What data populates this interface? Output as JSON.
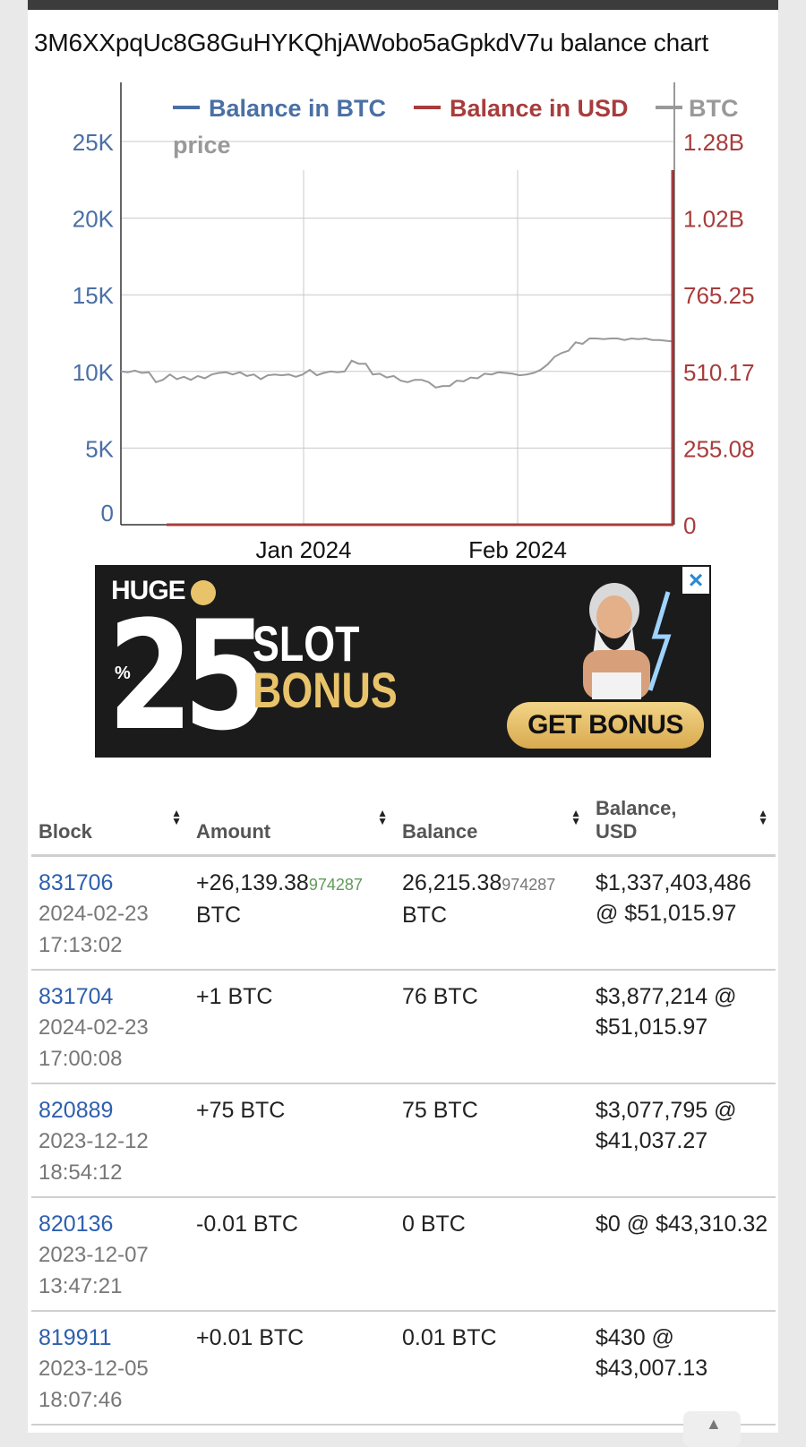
{
  "page_title": "3M6XXpqUc8G8GuHYKQhjAWobo5aGpkdV7u balance chart",
  "chart_data": {
    "type": "line",
    "legend": [
      {
        "label": "Balance in BTC",
        "color": "#4a6fa5"
      },
      {
        "label": "Balance in USD",
        "color": "#a83c3c"
      },
      {
        "label": "BTC price",
        "color": "#999999"
      }
    ],
    "legend_placement": "top",
    "grid": true,
    "y_left_ticks": [
      "0",
      "5K",
      "10K",
      "15K",
      "20K",
      "25K"
    ],
    "y_left_range": [
      0,
      25000
    ],
    "y_right_ticks": [
      "0",
      "255.08",
      "510.17",
      "765.25",
      "1.02B",
      "1.28B"
    ],
    "x_ticks": [
      "Jan 2024",
      "Feb 2024"
    ],
    "series": [
      {
        "name": "BTC price",
        "color": "#999999",
        "x": [
          0,
          1,
          2,
          3,
          4,
          5,
          6,
          7,
          8,
          9,
          10,
          11,
          12,
          13,
          14,
          15,
          16,
          17,
          18,
          19,
          20,
          21,
          22,
          23,
          24,
          25,
          26,
          27,
          28,
          29,
          30,
          31,
          32,
          33,
          34,
          35,
          36,
          37,
          38,
          39,
          40,
          41,
          42,
          43,
          44,
          45,
          46,
          47,
          48,
          49,
          50,
          51,
          52,
          53,
          54,
          55,
          56,
          57,
          58,
          59,
          60,
          61,
          62,
          63,
          64,
          65,
          66,
          67,
          68,
          69,
          70,
          71,
          72,
          73,
          74,
          75,
          76,
          77,
          78,
          79
        ],
        "values": [
          10000,
          9950,
          10050,
          9900,
          9950,
          9300,
          9450,
          9800,
          9500,
          9650,
          9450,
          9700,
          9550,
          9800,
          9900,
          9950,
          9800,
          9950,
          9700,
          9800,
          9500,
          9750,
          9800,
          9750,
          9800,
          9650,
          9800,
          10100,
          9750,
          9900,
          10000,
          9950,
          10000,
          10700,
          10500,
          10500,
          9800,
          9850,
          9600,
          9700,
          9400,
          9300,
          9450,
          9450,
          9300,
          8950,
          9050,
          9050,
          9400,
          9350,
          9600,
          9550,
          9850,
          9800,
          9950,
          9900,
          9850,
          9750,
          9800,
          9900,
          10100,
          10450,
          10950,
          11200,
          11350,
          11900,
          11800,
          12150,
          12150,
          12100,
          12150,
          12150,
          12050,
          12150,
          12100,
          12150,
          12050,
          12050,
          12000,
          11950
        ]
      },
      {
        "name": "Balance in BTC",
        "color": "#4a6fa5",
        "points": [
          [
            0,
            0
          ],
          [
            79,
            0
          ],
          [
            79,
            26215.38974287
          ]
        ]
      },
      {
        "name": "Balance in USD",
        "color": "#a83c3c",
        "points": [
          [
            0,
            0
          ],
          [
            79,
            0
          ],
          [
            79,
            1337403486
          ]
        ]
      }
    ]
  },
  "ad": {
    "brand": "HUGE",
    "percent_sign": "%",
    "number": "25",
    "line1": "SLOT",
    "line2": "BONUS",
    "cta": "GET BONUS",
    "close": "×"
  },
  "table": {
    "headers": [
      "Block",
      "Amount",
      "Balance",
      "Balance, USD"
    ],
    "sort_glyph": "▲\n▼",
    "rows": [
      {
        "block": "831706",
        "date": "2024-02-23",
        "time": "17:13:02",
        "amount_main": "+26,139.38",
        "amount_small": "974287",
        "amount_unit": "BTC",
        "amount_sign": "pos",
        "balance_main": "26,215.38",
        "balance_small": "974287",
        "balance_unit": "BTC",
        "usd": "$1,337,403,486 @ $51,015.97"
      },
      {
        "block": "831704",
        "date": "2024-02-23",
        "time": "17:00:08",
        "amount_main": "+1 BTC",
        "amount_small": "",
        "amount_unit": "",
        "amount_sign": "pos",
        "balance_main": "76 BTC",
        "balance_small": "",
        "balance_unit": "",
        "usd": "$3,877,214 @ $51,015.97"
      },
      {
        "block": "820889",
        "date": "2023-12-12",
        "time": "18:54:12",
        "amount_main": "+75 BTC",
        "amount_small": "",
        "amount_unit": "",
        "amount_sign": "pos",
        "balance_main": "75 BTC",
        "balance_small": "",
        "balance_unit": "",
        "usd": "$3,077,795 @ $41,037.27"
      },
      {
        "block": "820136",
        "date": "2023-12-07",
        "time": "13:47:21",
        "amount_main": "-0.01 BTC",
        "amount_small": "",
        "amount_unit": "",
        "amount_sign": "neg",
        "balance_main": "0 BTC",
        "balance_small": "",
        "balance_unit": "",
        "usd": "$0 @ $43,310.32"
      },
      {
        "block": "819911",
        "date": "2023-12-05",
        "time": "18:07:46",
        "amount_main": "+0.01 BTC",
        "amount_small": "",
        "amount_unit": "",
        "amount_sign": "pos",
        "balance_main": "0.01 BTC",
        "balance_small": "",
        "balance_unit": "",
        "usd": "$430 @ $43,007.13"
      }
    ]
  },
  "scroll_icon": "▲"
}
